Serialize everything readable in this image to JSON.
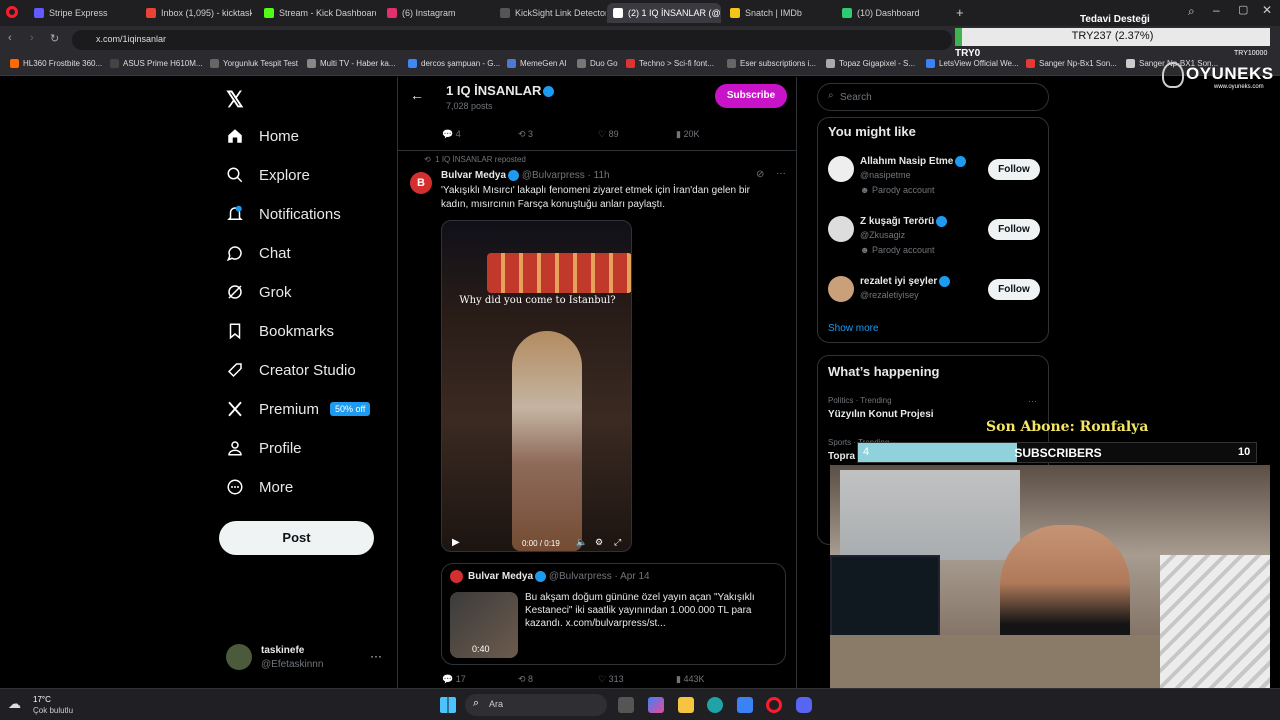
{
  "tabs": [
    {
      "label": "Stripe Express",
      "color": "#635bff"
    },
    {
      "label": "Inbox (1,095) - kicktaskine",
      "color": "#ea4335"
    },
    {
      "label": "Stream - Kick Dashboard",
      "color": "#53fc18"
    },
    {
      "label": "(6) Instagram",
      "color": "#e1306c"
    },
    {
      "label": "KickSight Link Detector",
      "color": "#555555"
    },
    {
      "label": "(2) 1 IQ İNSANLAR (@1iq",
      "color": "#ffffff"
    },
    {
      "label": "Snatch | IMDb",
      "color": "#f5c518"
    },
    {
      "label": "(10) Dashboard",
      "color": "#2ecc71"
    }
  ],
  "browser": {
    "url": "x.com/1iqinsanlar"
  },
  "bookmarks": [
    "HL360 Frostbite 360...",
    "ASUS Prime H610M...",
    "Yorgunluk Tespit Test",
    "Multi TV - Haber ka...",
    "dercos şampuan - G...",
    "MemeGen AI",
    "Duo Go",
    "Techno > Sci-fi font...",
    "Eser subscriptions i...",
    "Topaz Gigapixel - S...",
    "LetsView Official We...",
    "Sanger Np-Bx1 Son...",
    "Sanger Np-BX1 Son..."
  ],
  "overlay": {
    "donation_title": "Tedavi Desteği",
    "donation_amount": "TRY237 (2.37%)",
    "donation_min": "TRY0",
    "donation_max": "TRY10000",
    "progress": 0.0237,
    "sponsor": "OYUNEKS",
    "sponsor_site": "www.oyuneks.com",
    "last_sub_label": "Son Abone: Ronfalya",
    "subs_current": "4",
    "subs_label": "SUBSCRIBERS",
    "subs_goal": "10"
  },
  "sidebar": {
    "items": [
      "Home",
      "Explore",
      "Notifications",
      "Chat",
      "Grok",
      "Bookmarks",
      "Creator Studio",
      "Premium",
      "Profile",
      "More"
    ],
    "premium_badge": "50% off",
    "post_button": "Post",
    "user_name": "taskinefe",
    "user_handle": "@Efetaskinnn",
    "more_dots": "···"
  },
  "profile_header": {
    "name": "1 IQ İNSANLAR",
    "posts": "7,028 posts",
    "subscribe": "Subscribe"
  },
  "prev_stats": {
    "replies": "4",
    "reposts": "3",
    "likes": "89",
    "views": "20K"
  },
  "tweet": {
    "reposted_by": "1 IQ İNSANLAR reposted",
    "author": "Bulvar Medya",
    "handle": "@Bulvarpress",
    "time": "· 11h",
    "text": "'Yakışıklı Mısırcı' lakaplı fenomeni ziyaret etmek için İran'dan gelen bir kadın, mısırcının Farsça konuştuğu anları paylaştı.",
    "video_caption": "Why did you come to Istanbul?",
    "video_time": "0:00 / 0:19",
    "quote": {
      "author": "Bulvar Medya",
      "handle": "@Bulvarpress",
      "date": "· Apr 14",
      "text": "Bu akşam doğum gününe özel yayın açan \"Yakışıklı Kestaneci\" iki saatlik yayınından 1.000.000 TL para kazandı.  x.com/bulvarpress/st...",
      "duration": "0:40"
    },
    "stats": {
      "replies": "17",
      "reposts": "8",
      "likes": "313",
      "views": "443K"
    }
  },
  "right": {
    "search_placeholder": "Search",
    "might_like_title": "You might like",
    "suggestions": [
      {
        "name": "Allahım Nasip Etme",
        "handle": "@nasipetme",
        "note": "Parody account"
      },
      {
        "name": "Z kuşağı Terörü",
        "handle": "@Zkusagiz",
        "note": "Parody account"
      },
      {
        "name": "rezalet iyi şeyler",
        "handle": "@rezaletiyisey",
        "note": ""
      }
    ],
    "follow_label": "Follow",
    "show_more": "Show more",
    "happening_title": "What’s happening",
    "trend_category": "Politics · Trending",
    "trend_name": "Yüzyılın Konut Projesi",
    "trend2_category": "Sports · Trending",
    "trend2_name": "Topra"
  },
  "taskbar": {
    "weather_temp": "17°C",
    "weather_desc": "Çok bulutlu",
    "search": "Ara"
  }
}
